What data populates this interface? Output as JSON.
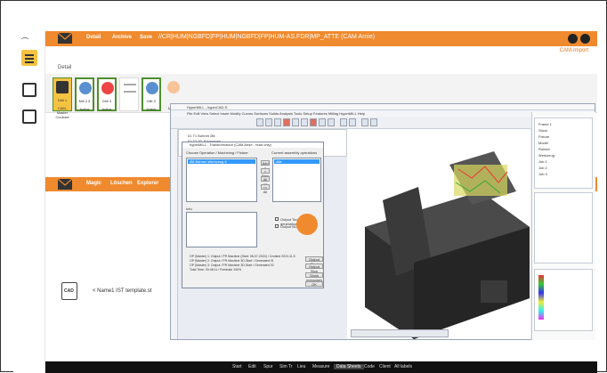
{
  "header": {
    "nav": [
      "Detail",
      "Archive",
      "Save"
    ],
    "path": "//CR|HUM|NGBFD|FP|HUM|NGBFD|FP|HUM-AS.FDR|MP_ATTE (CAM Arnie)",
    "right_link": "CAM-Import"
  },
  "subheader": {
    "label": "Detail"
  },
  "ribbon": {
    "items": [
      {
        "label": "Drill 1",
        "sub": "CAM-Master Contract"
      },
      {
        "label": "Mill 2.5",
        "sub": "Active"
      },
      {
        "label": "Drill 3",
        "sub": "Active"
      },
      {
        "label": "",
        "sub": ""
      },
      {
        "label": "Mill 3",
        "sub": "Active"
      },
      {
        "label": "",
        "sub": "Mill 3D"
      }
    ]
  },
  "cam_window": {
    "title": "HyperMILL - hyperCAD-S",
    "menu": "File  Edit  View  Select  Insert  Modify  Curves  Surfaces  Solids  Analysis  Tools  Setup  Features  Milling  HyperMILL  Help",
    "tree_items": [
      "01 T1 Bohren Ø6",
      "02 T2 3D-Schruppen",
      "03 T3 3D-Schlichten",
      "04 T4 Konturfräsen"
    ],
    "right_tree": [
      "Frame 1",
      "Stock",
      "Fixture",
      "Model",
      "Rohteil",
      "Werkzeug",
      "Job 1",
      "Job 2",
      "Job 3"
    ],
    "dialog": {
      "title": "hyperMILL - Transformation (CAM Arnie - read only)",
      "label_left": "Choose Operation / Machining / Fixture",
      "label_right": "Current assembly operations",
      "selected_left": "Ø8 Bohren  Werkzeug 6",
      "selected_right": "Alle",
      "buttons": [
        "Add >",
        "< Rem",
        "All >>",
        "<< All"
      ],
      "section_label": "Info",
      "status_lines": [
        "OP (Master) 1: Output / PR Machine (Start: 08-07-2024) / Created 2024.11.5",
        "OP (Master) 2: Output / PR Machine 3D-Start / Generated 01",
        "OP (Master) 3: Output / PR Machine 3D-Start / Generated 02",
        "Total Time: 00:48:11 / Feedrate 100%"
      ],
      "action_buttons": [
        "Output Start",
        "Output Stop",
        "Show messages",
        "OK"
      ],
      "checkbox_labels": [
        "Output Toolpath generation",
        "Output NC-generation"
      ]
    }
  },
  "middle_bar": {
    "items": [
      "Magic",
      "Löschen",
      "Explorer"
    ]
  },
  "file": {
    "icon_text": "CAD",
    "name": "< Name1 IST template.st"
  },
  "bottombar": {
    "items": [
      "Start",
      "Edit",
      "Spur",
      "Sim Tr",
      "Lieu",
      "Measure",
      "Data Sheets",
      "Code",
      "Client",
      "All labels"
    ],
    "active_index": 6
  },
  "colors": {
    "accent": "#f08a2e",
    "dark": "#111111"
  }
}
